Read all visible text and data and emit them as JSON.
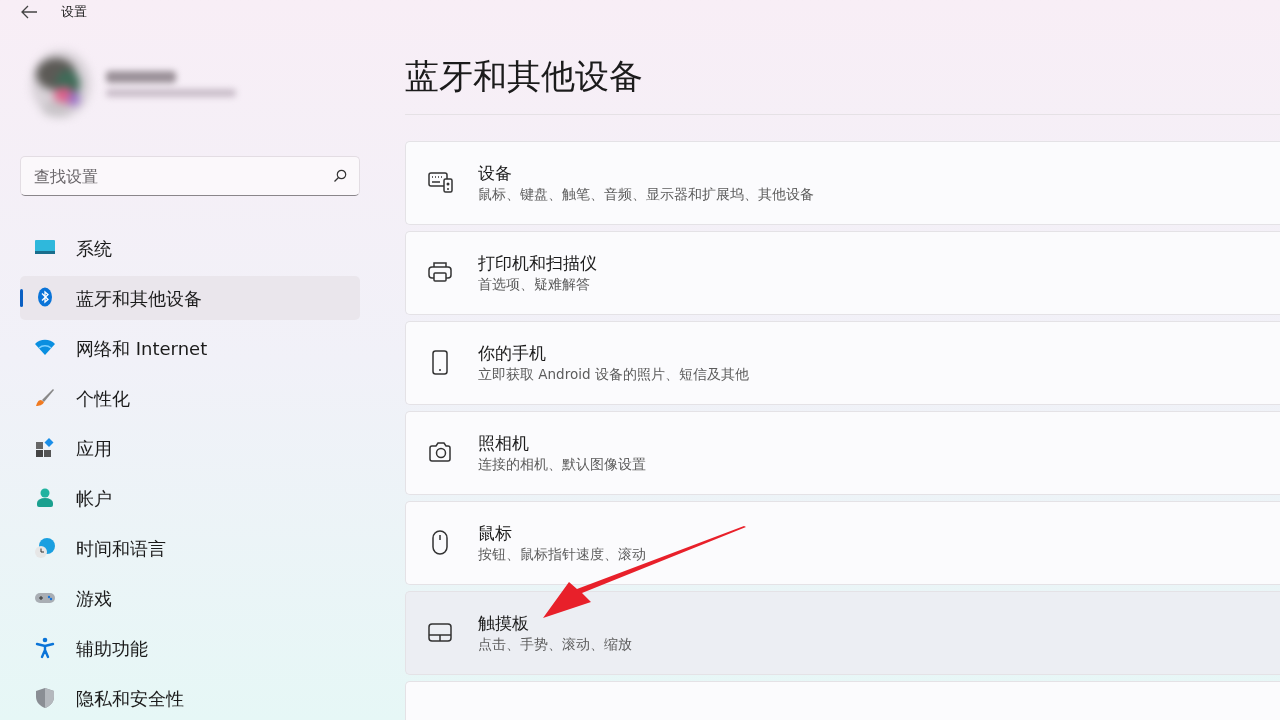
{
  "window": {
    "title": "设置"
  },
  "search": {
    "placeholder": "查找设置"
  },
  "sidebar": {
    "items": [
      {
        "label": "系统",
        "kind": "system",
        "selected": false
      },
      {
        "label": "蓝牙和其他设备",
        "kind": "bluetooth",
        "selected": true
      },
      {
        "label": "网络和 Internet",
        "kind": "network",
        "selected": false
      },
      {
        "label": "个性化",
        "kind": "brush",
        "selected": false
      },
      {
        "label": "应用",
        "kind": "apps",
        "selected": false
      },
      {
        "label": "帐户",
        "kind": "account",
        "selected": false
      },
      {
        "label": "时间和语言",
        "kind": "time",
        "selected": false
      },
      {
        "label": "游戏",
        "kind": "gaming",
        "selected": false
      },
      {
        "label": "辅助功能",
        "kind": "accessibility",
        "selected": false
      },
      {
        "label": "隐私和安全性",
        "kind": "privacy",
        "selected": false
      }
    ]
  },
  "page": {
    "title": "蓝牙和其他设备",
    "cards": [
      {
        "title": "设备",
        "subtitle": "鼠标、键盘、触笔、音频、显示器和扩展坞、其他设备",
        "kind": "devices",
        "hovered": false
      },
      {
        "title": "打印机和扫描仪",
        "subtitle": "首选项、疑难解答",
        "kind": "printer",
        "hovered": false
      },
      {
        "title": "你的手机",
        "subtitle": "立即获取 Android 设备的照片、短信及其他",
        "kind": "phone",
        "hovered": false
      },
      {
        "title": "照相机",
        "subtitle": "连接的相机、默认图像设置",
        "kind": "camera",
        "hovered": false
      },
      {
        "title": "鼠标",
        "subtitle": "按钮、鼠标指针速度、滚动",
        "kind": "mouse",
        "hovered": false
      },
      {
        "title": "触摸板",
        "subtitle": "点击、手势、滚动、缩放",
        "kind": "touchpad",
        "hovered": true
      }
    ]
  }
}
